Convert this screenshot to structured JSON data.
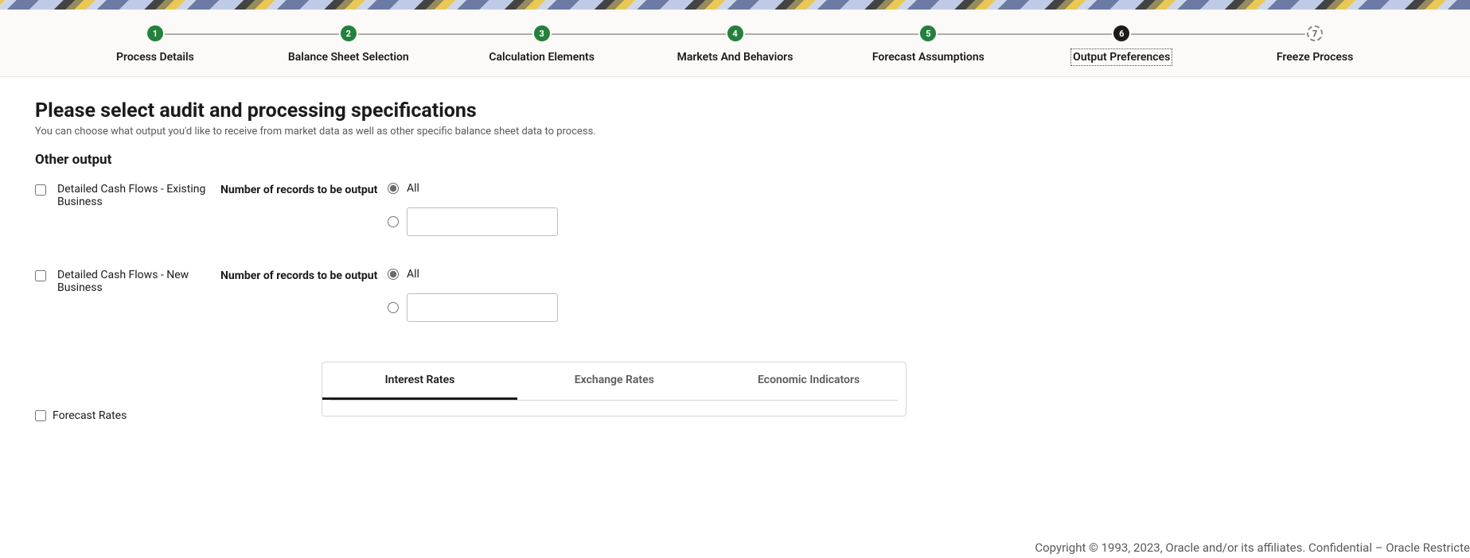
{
  "stepper": {
    "steps": [
      {
        "num": "1",
        "label": "Process Details",
        "state": "completed"
      },
      {
        "num": "2",
        "label": "Balance Sheet Selection",
        "state": "completed"
      },
      {
        "num": "3",
        "label": "Calculation Elements",
        "state": "completed"
      },
      {
        "num": "4",
        "label": "Markets And Behaviors",
        "state": "completed"
      },
      {
        "num": "5",
        "label": "Forecast Assumptions",
        "state": "completed"
      },
      {
        "num": "6",
        "label": "Output Preferences",
        "state": "current"
      },
      {
        "num": "7",
        "label": "Freeze Process",
        "state": "pending"
      }
    ]
  },
  "page": {
    "title": "Please select audit and processing specifications",
    "subtitle": "You can choose what output you'd like to receive from market data as well as other specific balance sheet data to process."
  },
  "section": {
    "other_output": "Other output"
  },
  "outputs": {
    "existing": {
      "label": "Detailed Cash Flows - Existing Business",
      "records_label": "Number of records to be output",
      "all": "All"
    },
    "new": {
      "label": "Detailed Cash Flows - New Business",
      "records_label": "Number of records to be output",
      "all": "All"
    },
    "forecast": {
      "label": "Forecast Rates"
    }
  },
  "tabs": {
    "interest": "Interest Rates",
    "exchange": "Exchange Rates",
    "economic": "Economic Indicators"
  },
  "footer": {
    "text": "Copyright © 1993, 2023, Oracle and/or its affiliates.   Confidential – Oracle Restricte"
  }
}
